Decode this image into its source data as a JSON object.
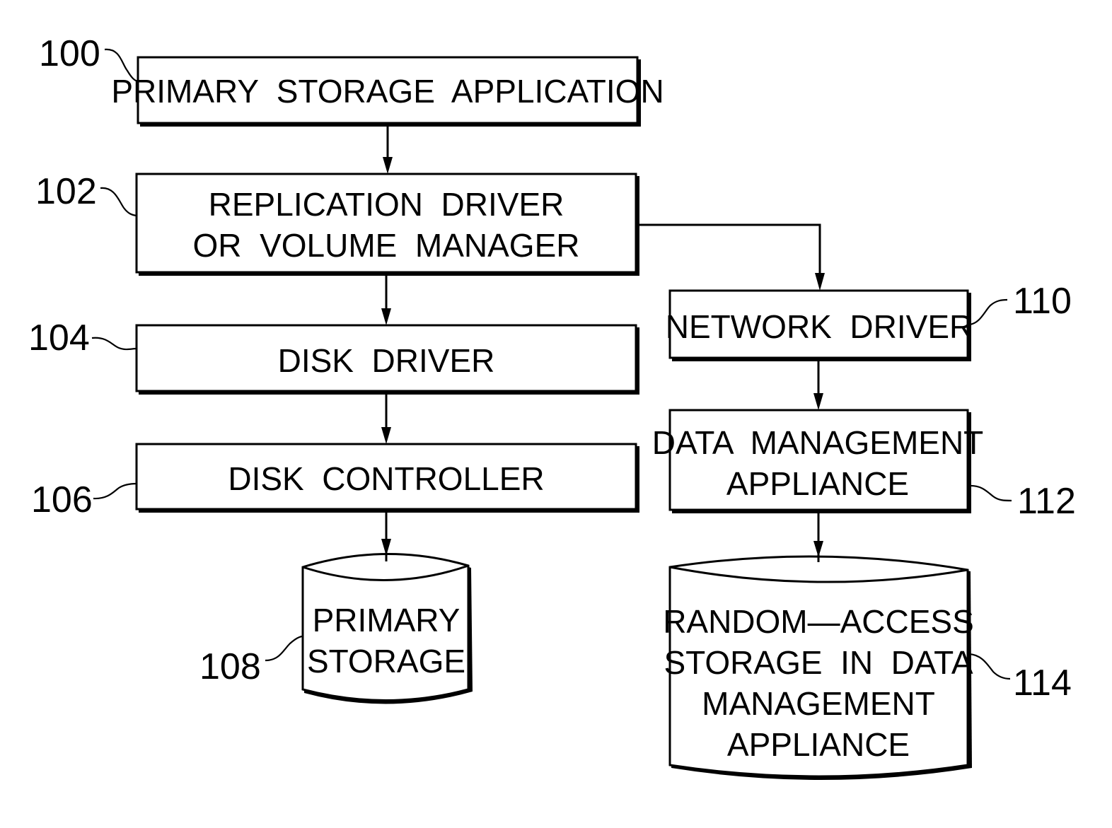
{
  "diagram": {
    "type": "block-diagram",
    "nodes": [
      {
        "id": "n100",
        "ref": "100",
        "shape": "box",
        "lines": [
          "PRIMARY  STORAGE  APPLICATION"
        ]
      },
      {
        "id": "n102",
        "ref": "102",
        "shape": "box",
        "lines": [
          "REPLICATION  DRIVER",
          "OR  VOLUME  MANAGER"
        ]
      },
      {
        "id": "n104",
        "ref": "104",
        "shape": "box",
        "lines": [
          "DISK  DRIVER"
        ]
      },
      {
        "id": "n106",
        "ref": "106",
        "shape": "box",
        "lines": [
          "DISK  CONTROLLER"
        ]
      },
      {
        "id": "n108",
        "ref": "108",
        "shape": "cylinder",
        "lines": [
          "PRIMARY",
          "STORAGE"
        ]
      },
      {
        "id": "n110",
        "ref": "110",
        "shape": "box",
        "lines": [
          "NETWORK  DRIVER"
        ]
      },
      {
        "id": "n112",
        "ref": "112",
        "shape": "box",
        "lines": [
          "DATA  MANAGEMENT",
          "APPLIANCE"
        ]
      },
      {
        "id": "n114",
        "ref": "114",
        "shape": "cylinder",
        "lines": [
          "RANDOM—ACCESS",
          "STORAGE  IN  DATA",
          "MANAGEMENT",
          "APPLIANCE"
        ]
      }
    ],
    "edges": [
      {
        "from": "n100",
        "to": "n102"
      },
      {
        "from": "n102",
        "to": "n104"
      },
      {
        "from": "n102",
        "to": "n110"
      },
      {
        "from": "n104",
        "to": "n106"
      },
      {
        "from": "n106",
        "to": "n108"
      },
      {
        "from": "n110",
        "to": "n112"
      },
      {
        "from": "n112",
        "to": "n114"
      }
    ]
  }
}
